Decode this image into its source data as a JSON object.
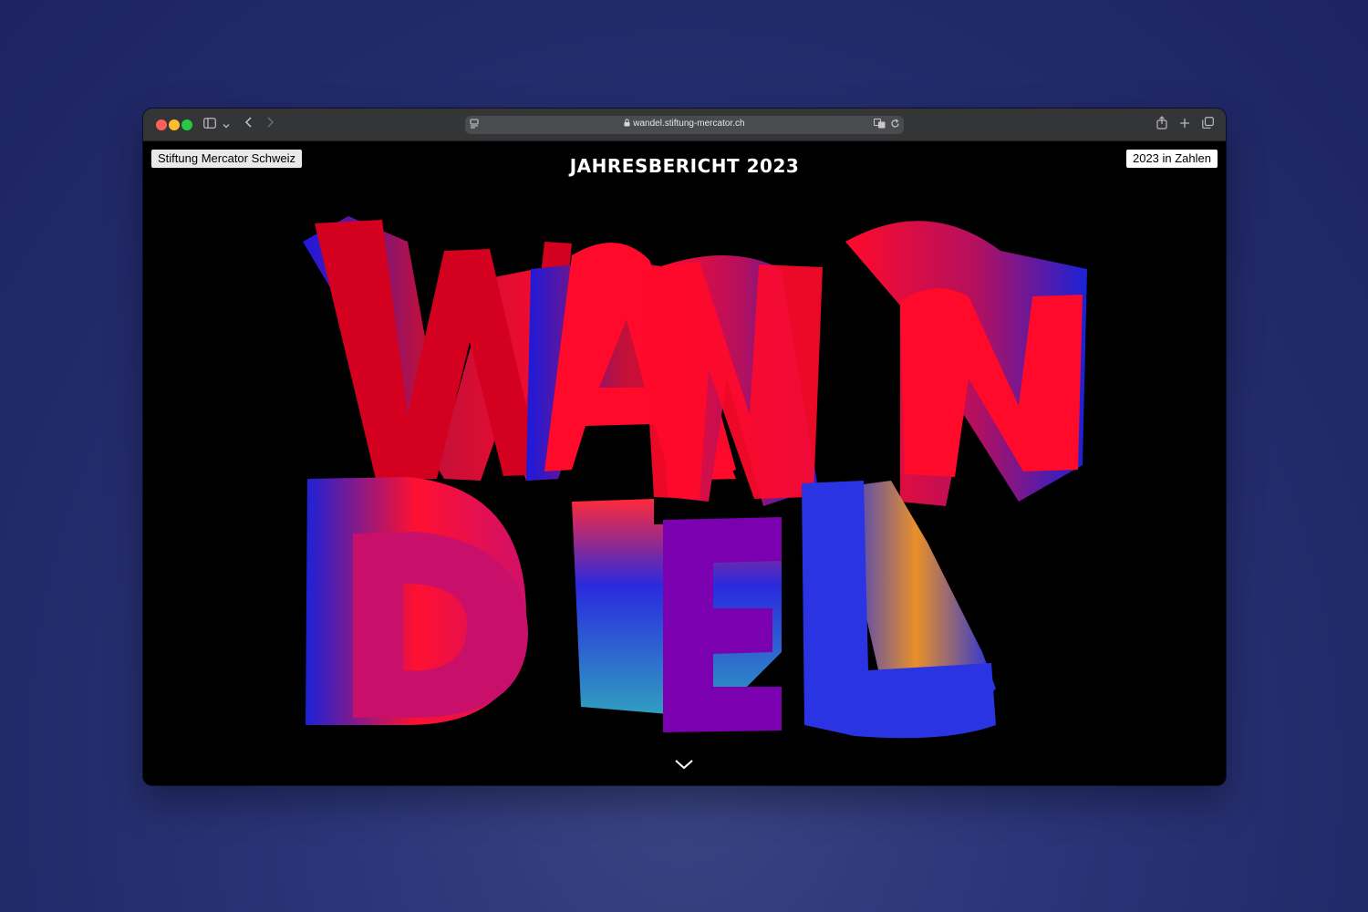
{
  "browser": {
    "url": "wandel.stiftung-mercator.ch",
    "icons": [
      "sidebar-icon",
      "chevron-down-icon",
      "back-icon",
      "forward-icon",
      "reader-icon",
      "lock-icon",
      "translate-icon",
      "reload-icon",
      "share-icon",
      "new-tab-icon",
      "tabs-overview-icon"
    ]
  },
  "page": {
    "brand_button": "Stiftung Mercator Schweiz",
    "title": "JAHRESBERICHT 2023",
    "numbers_button": "2023 in Zahlen",
    "hero_word_top": "WAN",
    "hero_word_bottom": "DEL",
    "scroll_icon": "chevron-down-icon"
  },
  "colors": {
    "backdrop": "#2c3578",
    "hero_red": "#ff0a2a",
    "hero_blue": "#2030e0",
    "hero_purple": "#7a00b0",
    "hero_orange": "#e8902a"
  }
}
